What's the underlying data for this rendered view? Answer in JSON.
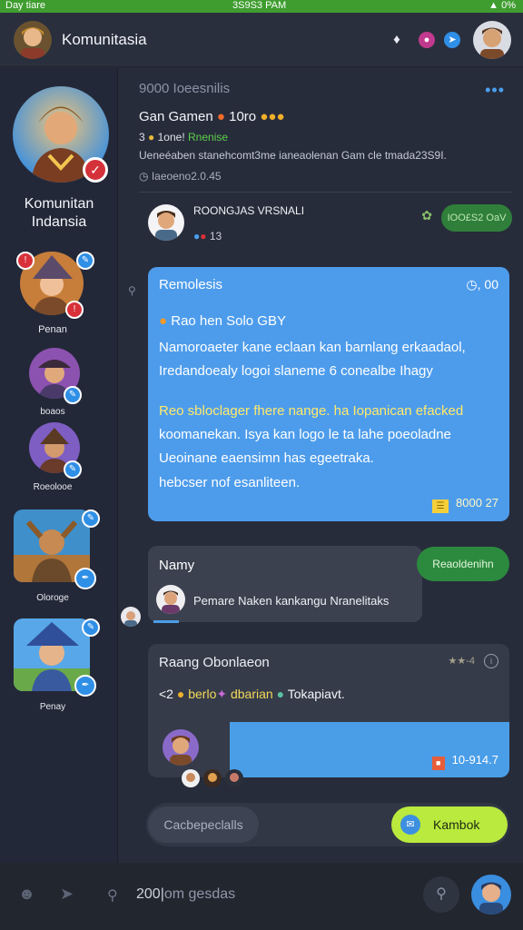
{
  "status_bar": {
    "left": "Day tiare",
    "time": "3S9S3 PAM",
    "battery": "0%"
  },
  "app_bar": {
    "title": "Komunitasia",
    "icons": [
      "puzzle-icon",
      "gamepad-icon",
      "share-icon"
    ]
  },
  "sidebar": {
    "community_name": "Komunitan Indansia",
    "members": [
      {
        "name": "Penan"
      },
      {
        "name": "boaos"
      },
      {
        "name": "Roeolooe"
      },
      {
        "name": "Oloroge"
      },
      {
        "name": "Penay"
      }
    ]
  },
  "main": {
    "section_title": "9000 Ioeesnilis",
    "group": {
      "title": "Gan Gamen",
      "title_suffix": "10ro",
      "meta_count": "3",
      "meta_label": "1one!",
      "meta_highlight": "Rnenise",
      "description": "Ueneéaben stanehcomt3me ianeaolenan Gam cle tmada23S9I.",
      "sub": "Iaeoeno2.0.45"
    },
    "post_header": {
      "name": "ROONGJAS VRSNALI",
      "meta": "13",
      "button": "IOO£S2 OaV"
    },
    "featured": {
      "title": "Remolesis",
      "time": "00",
      "subtitle": "Rao hen Solo GBY",
      "lines": [
        "Namoroaeter kane eclaan kan barnlang erkaadaol,",
        "Iredandoealy logoi slaneme 6 conealbe Ihagy"
      ],
      "highlight_lines": [
        "Reo sbloclager fhere nange. ha Iopanican efacked",
        "koomanekan. Isya kan logo le ta lahe poeoladne",
        "Ueoinane eaensimn has egeetraka."
      ],
      "last_line": "hebcser nof esanliteen.",
      "footer": "8000 27"
    },
    "reply": {
      "name": "Namy",
      "message": "Pemare Naken kankangu Nranelitaks",
      "pill": "Reaoldenihn"
    },
    "ghost": {
      "title": "Raang Obonlaeon",
      "stars": "★★-4",
      "line_prefix": "<2",
      "line_a": "berlo",
      "line_b": "dbarian",
      "line_c": "Tokapiavt.",
      "footer": "10-914.7"
    },
    "input": {
      "draft": "Cacbepeclalls",
      "send": "Kambok"
    }
  },
  "bottom_bar": {
    "value": "200",
    "placeholder": "om gesdas"
  }
}
